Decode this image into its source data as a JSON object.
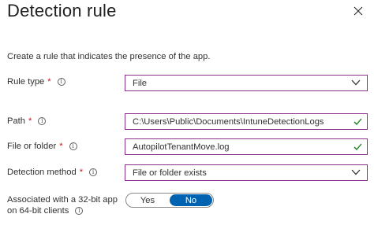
{
  "panel": {
    "title": "Detection rule",
    "description": "Create a rule that indicates the presence of the app."
  },
  "fields": {
    "rule_type": {
      "label": "Rule type",
      "required_mark": "*",
      "value": "File"
    },
    "path": {
      "label": "Path",
      "required_mark": "*",
      "value": "C:\\Users\\Public\\Documents\\IntuneDetectionLogs"
    },
    "file_or_folder": {
      "label": "File or folder",
      "required_mark": "*",
      "value": "AutopilotTenantMove.log"
    },
    "detection_method": {
      "label": "Detection method",
      "required_mark": "*",
      "value": "File or folder exists"
    },
    "associated_32bit": {
      "label_line1": "Associated with a 32-bit app",
      "label_line2": "on 64-bit clients",
      "options": [
        "Yes",
        "No"
      ],
      "selected": "No"
    }
  },
  "colors": {
    "field_border": "#8c2d8c",
    "required": "#c50f1f",
    "valid_check": "#107c10",
    "toggle_active": "#0063b1"
  },
  "icons": [
    "close-icon",
    "info-icon",
    "chevron-down-icon",
    "checkmark-icon"
  ]
}
